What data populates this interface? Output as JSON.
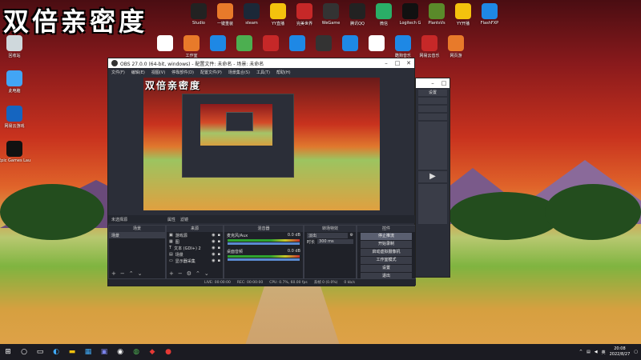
{
  "desktop": {
    "title_art": "双倍亲密度",
    "icons_top": [
      {
        "label": "Studio",
        "color": "#222"
      },
      {
        "label": "一键重装",
        "color": "#e87a2a"
      },
      {
        "label": "steam",
        "color": "#1b2838"
      },
      {
        "label": "YY直播",
        "color": "#f4c20d"
      },
      {
        "label": "完美世界",
        "color": "#c62828"
      },
      {
        "label": "WeGame",
        "color": "#333"
      },
      {
        "label": "腾讯QQ",
        "color": "#222"
      },
      {
        "label": "微信",
        "color": "#2aae67"
      },
      {
        "label": "Logitech G",
        "color": "#111"
      },
      {
        "label": "PlantsVs",
        "color": "#5a8a2a"
      },
      {
        "label": "YY开播",
        "color": "#f4c20d"
      },
      {
        "label": "FlashFXP",
        "color": "#1e88e5"
      }
    ],
    "icons_row2": [
      {
        "label": "",
        "color": "#fff"
      },
      {
        "label": "工作室",
        "color": "#e87a2a"
      },
      {
        "label": "",
        "color": "#1e88e5"
      },
      {
        "label": "",
        "color": "#4caf50"
      },
      {
        "label": "",
        "color": "#c62828"
      },
      {
        "label": "",
        "color": "#1e88e5"
      },
      {
        "label": "",
        "color": "#333"
      },
      {
        "label": "",
        "color": "#1e88e5"
      },
      {
        "label": "",
        "color": "#fff"
      },
      {
        "label": "酷狗音乐",
        "color": "#1e88e5"
      },
      {
        "label": "网易云音乐",
        "color": "#c62828"
      },
      {
        "label": "网页游",
        "color": "#e87a2a"
      }
    ],
    "icons_left": [
      {
        "label": "回收站",
        "color": "#cfd8dc"
      },
      {
        "label": "此电脑",
        "color": "#42a5f5"
      },
      {
        "label": "网易云游戏",
        "color": "#1565c0"
      },
      {
        "label": "Epic Games Launcher",
        "color": "#111"
      }
    ]
  },
  "obs": {
    "title": "OBS 27.0.0 (64-bit, windows) - 配置文件: 未命名 - 场景: 未命名",
    "menu": [
      "文件(F)",
      "编辑(E)",
      "视图(V)",
      "停靠部件(D)",
      "配置文件(P)",
      "场景集合(S)",
      "工具(T)",
      "帮助(H)"
    ],
    "scene_bar_left": "未选择源",
    "scene_bar_props": "属性",
    "scene_bar_filters": "滤镜",
    "docks": {
      "scenes": {
        "title": "场景",
        "items": [
          "场景"
        ]
      },
      "sources": {
        "title": "来源",
        "items": [
          "游戏源",
          "图",
          "文本 (GDI+) 2",
          "场景",
          "显示器采集"
        ]
      },
      "mixer": {
        "title": "混音器",
        "items": [
          {
            "name": "麦克风/Aux",
            "db": "0.0 dB"
          },
          {
            "name": "桌面音频",
            "db": "0.0 dB"
          }
        ]
      },
      "transitions": {
        "title": "转场特效",
        "type": "淡出",
        "duration_label": "时长",
        "duration_value": "300 ms"
      },
      "controls": {
        "title": "控件",
        "buttons": [
          "停止推流",
          "开始录制",
          "启动虚拟摄像机",
          "工作室模式",
          "设置",
          "退出"
        ]
      }
    },
    "status": {
      "drops": "丢帧 0 (0.0%)",
      "live": "LIVE: 00:00:00",
      "rec": "REC: 00:00:00",
      "cpu": "CPU: 0.7%, 60.00 fps",
      "kbps": "0 kb/s"
    }
  },
  "obs2": {
    "buttons": [
      "设置",
      "",
      "",
      "",
      ""
    ]
  },
  "taskbar": {
    "time": "20:08",
    "date": "2022/8/27",
    "lang": "英",
    "apps": [
      "windows",
      "search",
      "task-view",
      "edge",
      "explorer",
      "store",
      "teams",
      "obs",
      "chrome",
      "netease",
      "obs2"
    ]
  }
}
